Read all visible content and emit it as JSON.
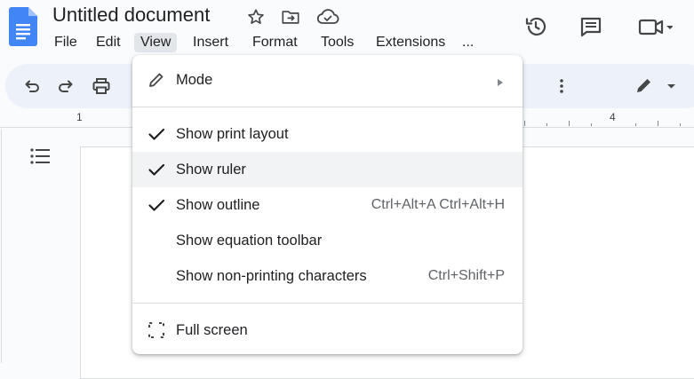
{
  "app": {
    "title": "Untitled document",
    "icons": [
      "docs-logo-icon",
      "star-icon",
      "move-folder-icon",
      "cloud-saved-icon",
      "history-icon",
      "comment-icon",
      "meet-video-icon",
      "caret-down-icon"
    ]
  },
  "menubar": {
    "items": [
      "File",
      "Edit",
      "View",
      "Insert",
      "Format",
      "Tools",
      "Extensions",
      "..."
    ],
    "active": "View"
  },
  "toolbar": {
    "icons": [
      "undo-icon",
      "redo-icon",
      "print-icon",
      "more-vert-icon",
      "edit-pencil-icon",
      "caret-down-icon"
    ]
  },
  "ruler": {
    "labels": [
      "1",
      "4"
    ]
  },
  "view_menu": {
    "items": [
      {
        "label": "Mode",
        "icon": "pencil-icon",
        "submenu": true
      },
      {
        "label": "Show print layout",
        "checked": true,
        "shortcut": ""
      },
      {
        "label": "Show ruler",
        "checked": true,
        "shortcut": ""
      },
      {
        "label": "Show outline",
        "checked": true,
        "shortcut": "Ctrl+Alt+A Ctrl+Alt+H"
      },
      {
        "label": "Show equation toolbar",
        "checked": false,
        "shortcut": ""
      },
      {
        "label": "Show non-printing characters",
        "checked": false,
        "shortcut": "Ctrl+Shift+P"
      },
      {
        "label": "Full screen",
        "icon": "fullscreen-icon",
        "shortcut": ""
      }
    ]
  },
  "colors": {
    "accent": "#4285f4",
    "toolbar_bg": "#edf2fa",
    "menu_hover": "#f1f3f4",
    "active_menu_bg": "#e2e6eb"
  }
}
